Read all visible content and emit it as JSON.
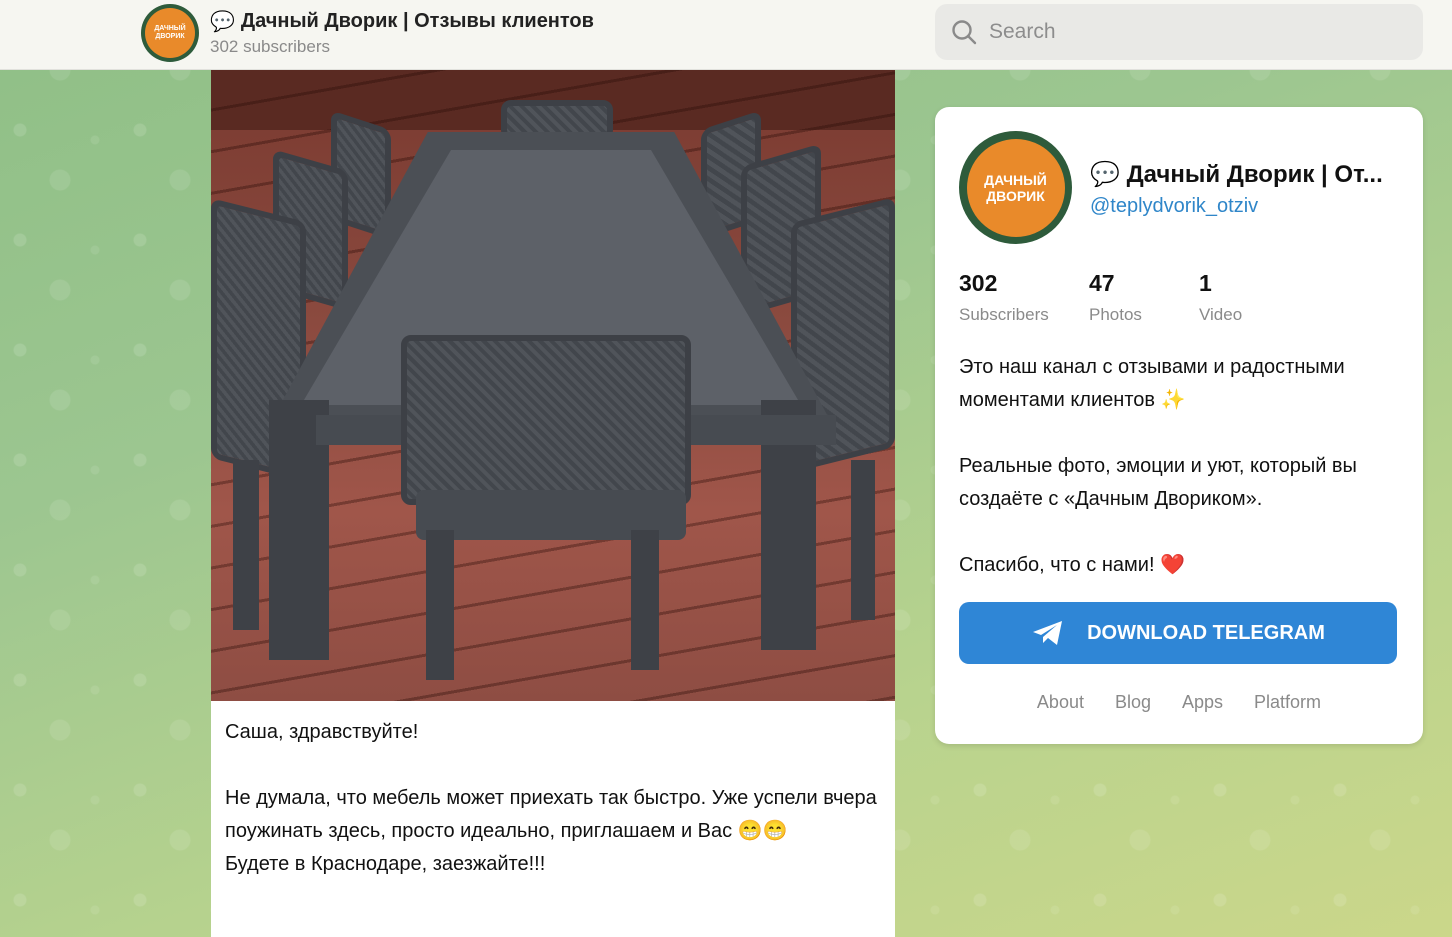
{
  "header": {
    "channel_emoji": "💬",
    "channel_title": "Дачный Дворик | Отзывы клиентов",
    "subscribers_text": "302 subscribers",
    "avatar_text": "ДАЧНЫЙ ДВОРИК"
  },
  "search": {
    "placeholder": "Search"
  },
  "post": {
    "lines": [
      "Саша, здравствуйте!",
      "",
      "Не думала, что мебель может приехать так быстро. Уже успели вчера поужинать здесь, просто идеально, приглашаем и Вас 😁😁",
      "Будете в Краснодаре, заезжайте!!!"
    ]
  },
  "card": {
    "name_emoji": "💬",
    "name": "Дачный Дворик | От...",
    "handle": "@teplydvorik_otziv",
    "stats": [
      {
        "num": "302",
        "label": "Subscribers"
      },
      {
        "num": "47",
        "label": "Photos"
      },
      {
        "num": "1",
        "label": "Video"
      }
    ],
    "description": [
      "Это наш канал с отзывами и радостными моментами клиентов ✨",
      "Реальные фото, эмоции и уют, который вы создаёте с «Дачным Двориком».",
      "Спасибо, что с нами! ❤️"
    ],
    "download_label": "DOWNLOAD TELEGRAM",
    "footer_links": [
      "About",
      "Blog",
      "Apps",
      "Platform"
    ]
  },
  "colors": {
    "accent": "#2f86d6",
    "handle": "#2f86c9",
    "background": "#9cc690"
  }
}
